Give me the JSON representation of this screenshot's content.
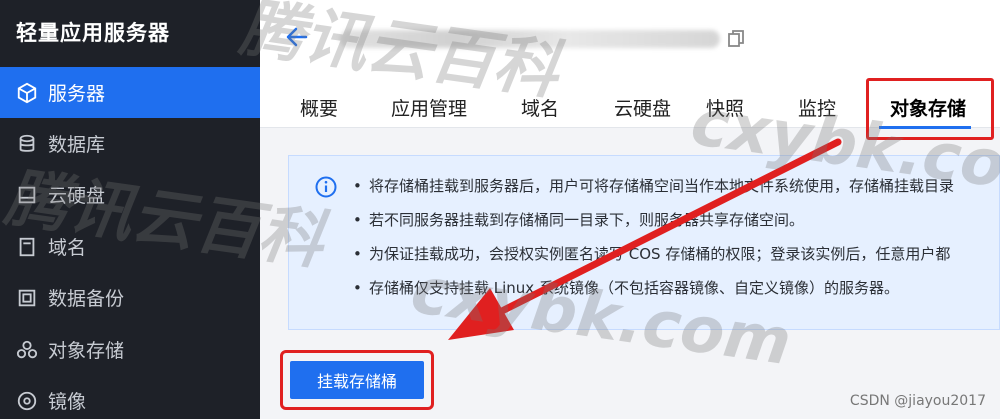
{
  "app": {
    "title": "轻量应用服务器"
  },
  "sidebar": {
    "items": [
      {
        "label": "服务器",
        "icon": "cube-icon",
        "active": true
      },
      {
        "label": "数据库",
        "icon": "database-icon",
        "active": false
      },
      {
        "label": "云硬盘",
        "icon": "disk-icon",
        "active": false
      },
      {
        "label": "域名",
        "icon": "domain-icon",
        "active": false
      },
      {
        "label": "数据备份",
        "icon": "backup-icon",
        "active": false
      },
      {
        "label": "对象存储",
        "icon": "storage-icon",
        "active": false
      },
      {
        "label": "镜像",
        "icon": "image-icon",
        "active": false
      }
    ]
  },
  "tabs": [
    {
      "label": "概要"
    },
    {
      "label": "应用管理"
    },
    {
      "label": "域名"
    },
    {
      "label": "云硬盘"
    },
    {
      "label": "快照"
    },
    {
      "label": "监控"
    },
    {
      "label": "对象存储",
      "active": true
    }
  ],
  "info": {
    "lines": [
      "将存储桶挂载到服务器后，用户可将存储桶空间当作本地文件系统使用，存储桶挂载目录",
      "若不同服务器挂载到存储桶同一目录下，则服务器共享存储空间。",
      "为保证挂载成功，会授权实例匿名读写 COS 存储桶的权限；登录该实例后，任意用户都",
      "存储桶仅支持挂载 Linux 系统镜像（不包括容器镜像、自定义镜像）的服务器。"
    ]
  },
  "actions": {
    "mount_button": "挂载存储桶"
  },
  "watermark": {
    "text1": "腾讯云百科",
    "text2": "cxybk.com",
    "credit": "CSDN @jiayou2017"
  },
  "colors": {
    "accent": "#1f6fef",
    "sidebar_bg": "#1e2128",
    "highlight": "#e02020",
    "info_bg": "#e6f0ff"
  }
}
